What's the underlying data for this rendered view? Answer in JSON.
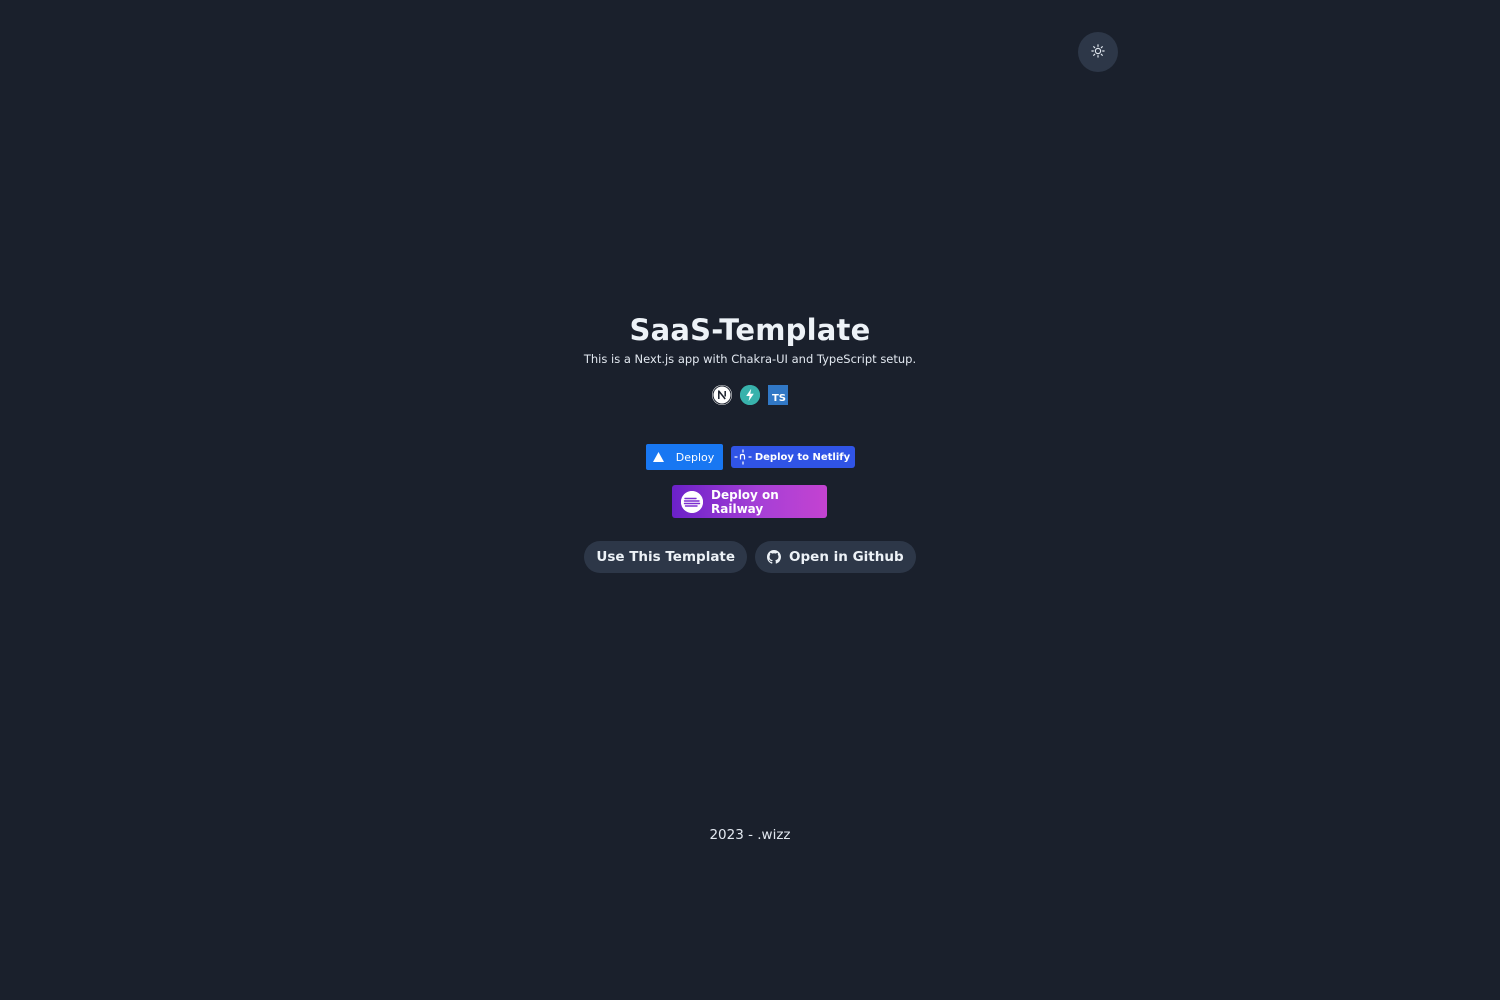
{
  "header": {
    "theme_toggle_icon": "sun-icon"
  },
  "hero": {
    "title": "SaaS-Template",
    "subtitle": "This is a Next.js app with Chakra-UI and TypeScript setup.",
    "tech_icons": [
      {
        "name": "nextjs-logo-icon",
        "glyph": "N"
      },
      {
        "name": "chakra-logo-icon",
        "glyph": ""
      },
      {
        "name": "typescript-logo-icon",
        "glyph": "TS"
      }
    ]
  },
  "deploy": {
    "vercel_label": "Deploy",
    "netlify_label": "Deploy to Netlify",
    "railway_label": "Deploy on Railway"
  },
  "actions": {
    "use_template_label": "Use This Template",
    "open_github_label": "Open in Github"
  },
  "footer": {
    "text": "2023 - .wizz"
  },
  "colors": {
    "background": "#1a202c",
    "pill": "#2d3748",
    "vercel_blue": "#1877f2",
    "netlify_blue": "#3054e6",
    "railway_gradient_start": "#6b21c8",
    "railway_gradient_end": "#c443d1"
  }
}
